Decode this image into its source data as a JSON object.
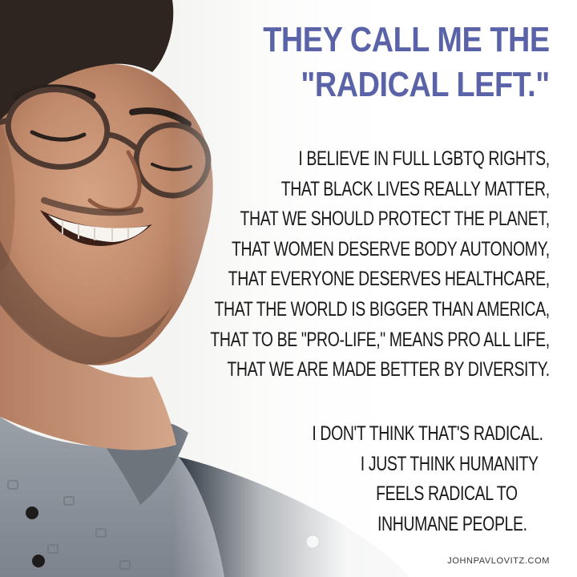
{
  "headline": {
    "lines": [
      "THEY CALL ME THE",
      "\"RADICAL LEFT.\""
    ],
    "color": "#5b63a8"
  },
  "beliefs": {
    "lines": [
      "I BELIEVE IN FULL LGBTQ RIGHTS,",
      "THAT BLACK LIVES REALLY MATTER,",
      "THAT WE SHOULD PROTECT THE PLANET,",
      "THAT WOMEN DESERVE BODY AUTONOMY,",
      "THAT EVERYONE DESERVES HEALTHCARE,",
      "THAT THE WORLD IS BIGGER THAN AMERICA,",
      "THAT TO BE \"PRO-LIFE,\" MEANS PRO ALL LIFE,",
      "THAT WE ARE MADE BETTER BY DIVERSITY."
    ]
  },
  "closing": {
    "lines": [
      "I DON'T THINK THAT'S RADICAL.",
      "I JUST THINK HUMANITY",
      "FEELS RADICAL TO",
      "INHUMANE PEOPLE."
    ]
  },
  "credit": "JOHNPAVLOVITZ.COM",
  "photo": {
    "subject": "smiling young man with glasses in a gray polo shirt and dark jacket",
    "colors": {
      "skin": "#c69476",
      "hair": "#2e2420",
      "shirt": "#8c929a",
      "jacket": "#27303c",
      "background": "#f4f4f2"
    }
  }
}
